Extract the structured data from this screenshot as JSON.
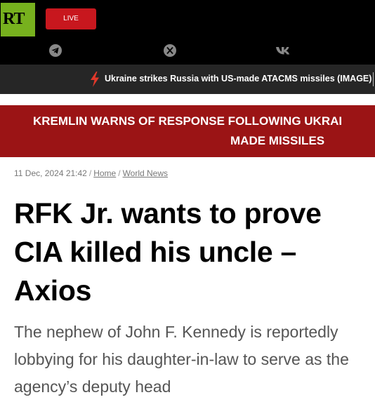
{
  "header": {
    "logo_text": "RT",
    "live_label": "LIVE",
    "social": [
      "telegram-icon",
      "x-icon",
      "vk-icon"
    ]
  },
  "ticker": {
    "text": "Ukraine strikes Russia with US-made ATACMS missiles (IMAGE)"
  },
  "banner": {
    "line1": "KREMLIN WARNS OF RESPONSE FOLLOWING UKRAI",
    "line2": "MADE MISSILES"
  },
  "article": {
    "date": "11 Dec, 2024 21:42",
    "breadcrumbs": [
      "Home",
      "World News"
    ],
    "title": "RFK Jr. wants to prove CIA killed his uncle – Axios",
    "summary": "The nephew of John F. Kennedy is reportedly lobbying for his daughter-in-law to serve as the agency’s deputy head"
  },
  "colors": {
    "logo_green": "#77b11e",
    "live_red": "#c8171e",
    "banner_red": "#9b1415",
    "ticker_bg": "#262626",
    "bolt": "#e0382a"
  }
}
